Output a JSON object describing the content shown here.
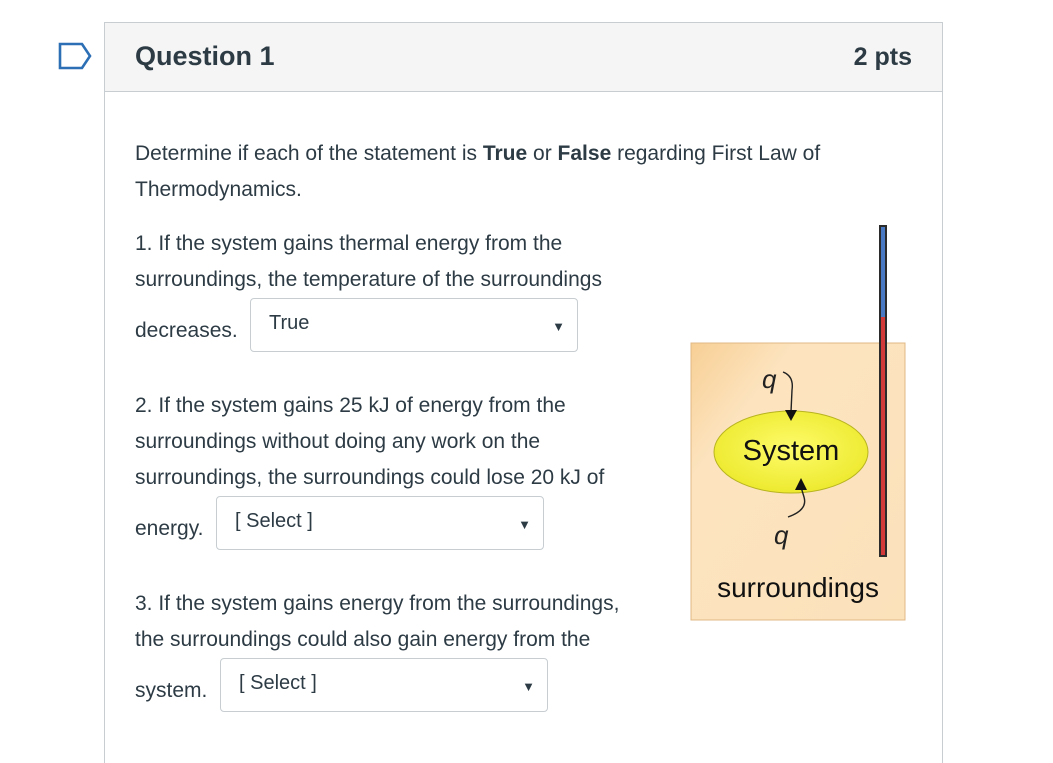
{
  "question": {
    "title": "Question 1",
    "points": "2 pts"
  },
  "intro": {
    "part1": "Determine if each of the statement is ",
    "bold_true": "True",
    "part2": " or ",
    "bold_false": "False",
    "part3": " regarding First Law of",
    "line2": "Thermodynamics."
  },
  "statements": [
    {
      "line1": "1. If the system gains thermal energy from the",
      "line2": "surroundings, the temperature of the surroundings",
      "line3": "decreases.",
      "selected": "True"
    },
    {
      "line1": "2. If the system gains 25 kJ of energy from the",
      "line2": "surroundings without doing any work on the",
      "line3": "surroundings, the surroundings could lose 20 kJ of",
      "line4": "energy.",
      "selected": "[ Select ]"
    },
    {
      "line1": "3. If the system gains energy from the surroundings,",
      "line2": "the surroundings could also gain energy from the",
      "line3": "system.",
      "selected": "[ Select ]"
    }
  ],
  "figure": {
    "q_top": "q",
    "system": "System",
    "q_bottom": "q",
    "surroundings": "surroundings"
  },
  "colors": {
    "box_fill": "#fbe0b6",
    "ellipse_fill": "#f5f23a",
    "thermo_blue": "#4a79c4",
    "thermo_red": "#d23a3a"
  }
}
